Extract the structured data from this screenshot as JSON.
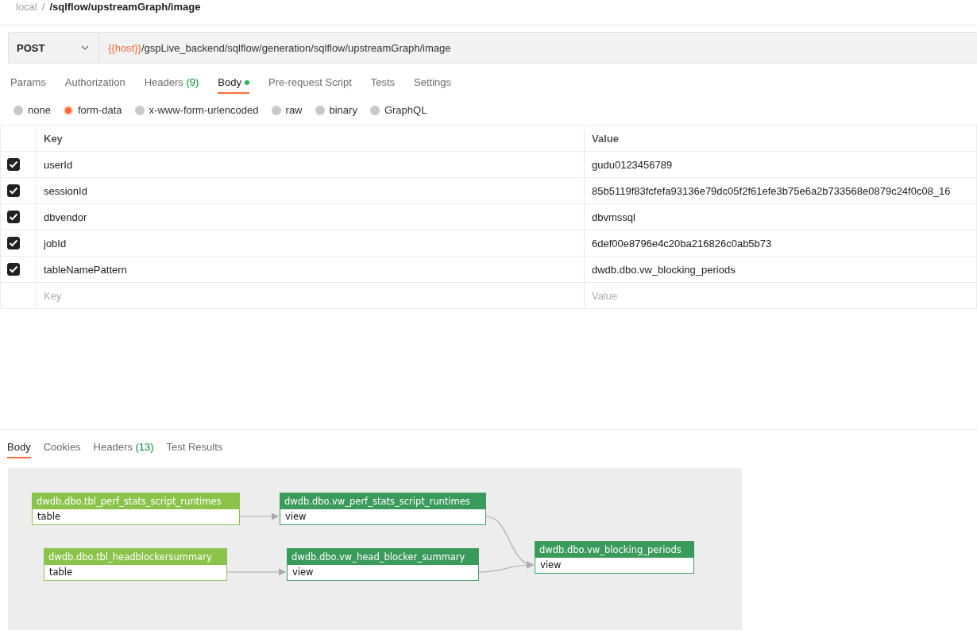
{
  "breadcrumb": {
    "collection": "local",
    "separator": "/",
    "request": "/sqlflow/upstreamGraph/image"
  },
  "request": {
    "method": "POST",
    "url_variable": "{{host}}",
    "url_path": "/gspLive_backend/sqlflow/generation/sqlflow/upstreamGraph/image"
  },
  "request_tabs": [
    {
      "label": "Params",
      "selected": false
    },
    {
      "label": "Authorization",
      "selected": false
    },
    {
      "label": "Headers",
      "count": "(9)",
      "selected": false
    },
    {
      "label": "Body",
      "indicator": true,
      "selected": true
    },
    {
      "label": "Pre-request Script",
      "selected": false
    },
    {
      "label": "Tests",
      "selected": false
    },
    {
      "label": "Settings",
      "selected": false
    }
  ],
  "body_types": [
    {
      "label": "none",
      "selected": false
    },
    {
      "label": "form-data",
      "selected": true
    },
    {
      "label": "x-www-form-urlencoded",
      "selected": false
    },
    {
      "label": "raw",
      "selected": false
    },
    {
      "label": "binary",
      "selected": false
    },
    {
      "label": "GraphQL",
      "selected": false
    }
  ],
  "form_table": {
    "columns": [
      "Key",
      "Value"
    ],
    "rows": [
      {
        "checked": true,
        "key": "userId",
        "value": "gudu0123456789"
      },
      {
        "checked": true,
        "key": "sessionId",
        "value": "85b5119f83fcfefa93136e79dc05f2f61efe3b75e6a2b733568e0879c24f0c08_16"
      },
      {
        "checked": true,
        "key": "dbvendor",
        "value": "dbvmssql"
      },
      {
        "checked": true,
        "key": "jobId",
        "value": "6def00e8796e4c20ba216826c0ab5b73"
      },
      {
        "checked": true,
        "key": "tableNamePattern",
        "value": "dwdb.dbo.vw_blocking_periods"
      }
    ],
    "new_row": {
      "key_placeholder": "Key",
      "value_placeholder": "Value"
    }
  },
  "response_tabs": [
    {
      "label": "Body",
      "selected": true
    },
    {
      "label": "Cookies",
      "selected": false
    },
    {
      "label": "Headers",
      "count": "(13)",
      "selected": false
    },
    {
      "label": "Test Results",
      "selected": false
    }
  ],
  "graph": {
    "nodes": [
      {
        "name": "dwdb.dbo.tbl_perf_stats_script_runtimes",
        "kind": "table",
        "type_label": "table"
      },
      {
        "name": "dwdb.dbo.vw_perf_stats_script_runtimes",
        "kind": "view",
        "type_label": "view"
      },
      {
        "name": "dwdb.dbo.tbl_headblockersummary",
        "kind": "table",
        "type_label": "table"
      },
      {
        "name": "dwdb.dbo.vw_head_blocker_summary",
        "kind": "view",
        "type_label": "view"
      },
      {
        "name": "dwdb.dbo.vw_blocking_periods",
        "kind": "view",
        "type_label": "view"
      }
    ]
  }
}
